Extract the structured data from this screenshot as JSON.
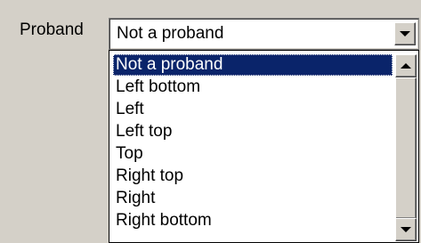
{
  "field": {
    "label": "Proband",
    "selected_value": "Not a proband"
  },
  "dropdown": {
    "items": [
      {
        "label": "Not a proband",
        "selected": true
      },
      {
        "label": "Left bottom",
        "selected": false
      },
      {
        "label": "Left",
        "selected": false
      },
      {
        "label": "Left top",
        "selected": false
      },
      {
        "label": "Top",
        "selected": false
      },
      {
        "label": "Right top",
        "selected": false
      },
      {
        "label": "Right",
        "selected": false
      },
      {
        "label": "Right bottom",
        "selected": false
      }
    ]
  },
  "icons": {
    "combo_button": "chevron-down-icon",
    "scroll_up": "scroll-up-icon",
    "scroll_down": "scroll-down-icon"
  },
  "colors": {
    "selection_bg": "#0a246a",
    "window_bg": "#d4d0c8"
  }
}
